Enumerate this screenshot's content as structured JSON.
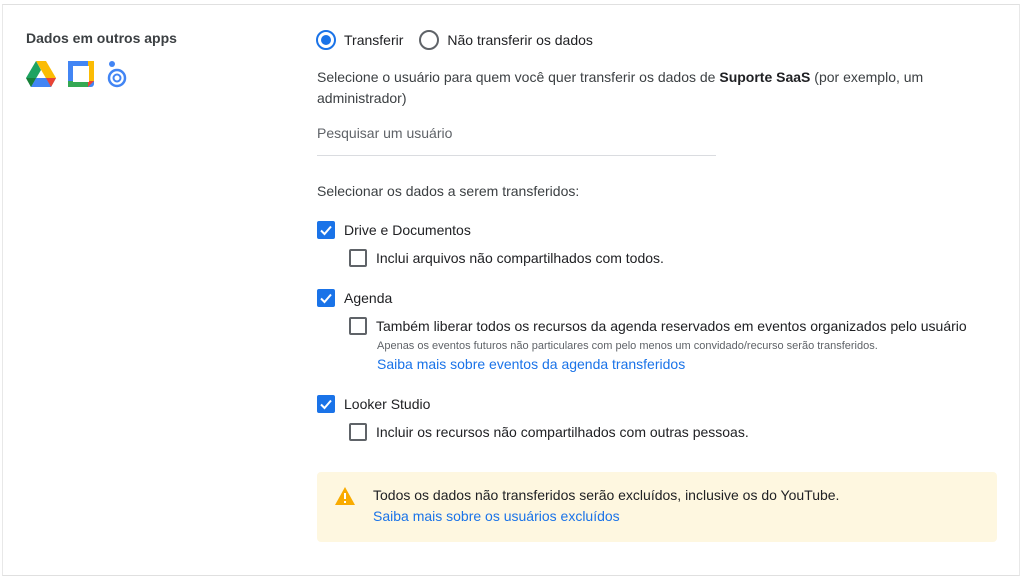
{
  "section": {
    "title": "Dados em outros apps",
    "apps": [
      "google-drive-icon",
      "google-calendar-icon",
      "looker-studio-icon"
    ]
  },
  "transfer_mode": {
    "options": [
      {
        "label": "Transferir",
        "selected": true
      },
      {
        "label": "Não transferir os dados",
        "selected": false
      }
    ]
  },
  "description": {
    "prefix": "Selecione o usuário para quem você quer transferir os dados de ",
    "bold": "Suporte SaaS",
    "suffix": " (por exemplo, um administrador)"
  },
  "search": {
    "placeholder": "Pesquisar um usuário",
    "value": ""
  },
  "data_selection": {
    "heading": "Selecionar os dados a serem transferidos:",
    "items": [
      {
        "label": "Drive e Documentos",
        "checked": true,
        "sub_label": "Inclui arquivos não compartilhados com todos.",
        "sub_checked": false
      },
      {
        "label": "Agenda",
        "checked": true,
        "sub_label": "Também liberar todos os recursos da agenda reservados em eventos organizados pelo usuário",
        "sub_checked": false,
        "note": "Apenas os eventos futuros não particulares com pelo menos um convidado/recurso serão transferidos.",
        "link": "Saiba mais sobre eventos da agenda transferidos"
      },
      {
        "label": "Looker Studio",
        "checked": true,
        "sub_label": "Incluir os recursos não compartilhados com outras pessoas.",
        "sub_checked": false
      }
    ]
  },
  "warning": {
    "icon": "warning-icon",
    "color": "#f9ab00",
    "background": "#fef7e0",
    "text": "Todos os dados não transferidos serão excluídos, inclusive os do YouTube.",
    "link": "Saiba mais sobre os usuários excluídos"
  },
  "colors": {
    "accent": "#1a73e8",
    "text": "#202124"
  }
}
